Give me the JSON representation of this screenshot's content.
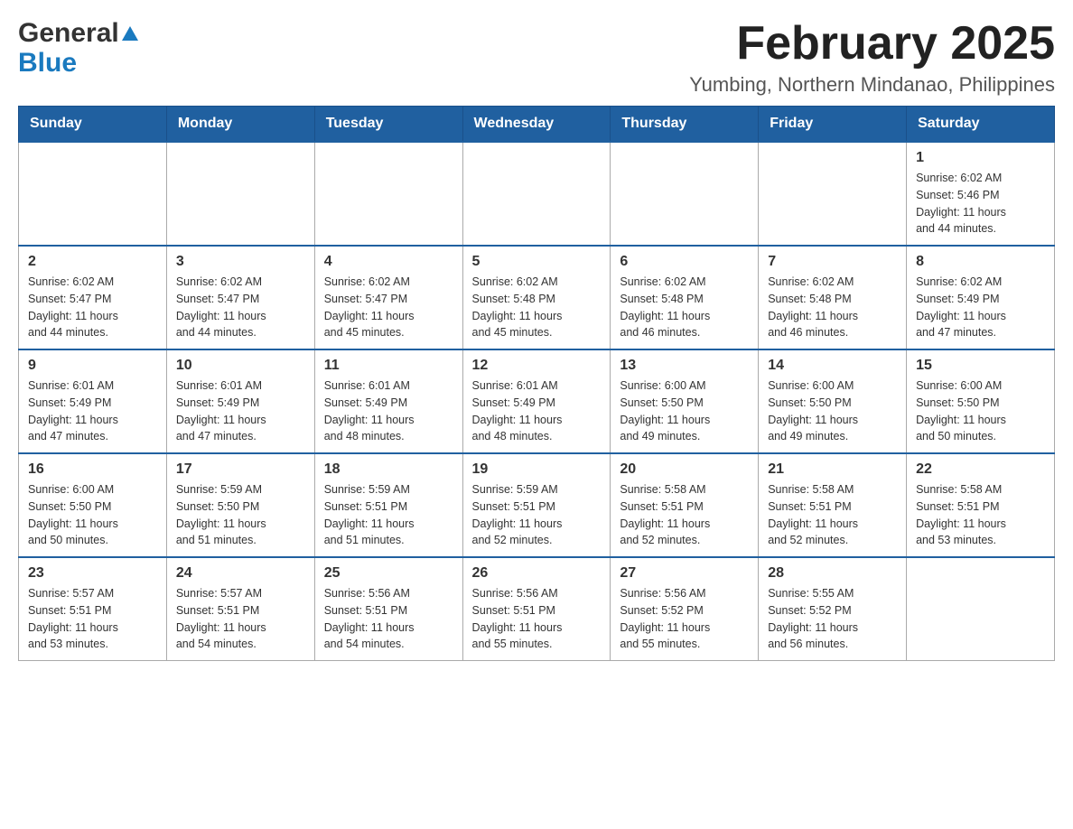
{
  "logo": {
    "general": "General",
    "blue": "Blue"
  },
  "header": {
    "month_year": "February 2025",
    "location": "Yumbing, Northern Mindanao, Philippines"
  },
  "days_of_week": [
    "Sunday",
    "Monday",
    "Tuesday",
    "Wednesday",
    "Thursday",
    "Friday",
    "Saturday"
  ],
  "weeks": [
    {
      "cells": [
        {
          "day": "",
          "info": ""
        },
        {
          "day": "",
          "info": ""
        },
        {
          "day": "",
          "info": ""
        },
        {
          "day": "",
          "info": ""
        },
        {
          "day": "",
          "info": ""
        },
        {
          "day": "",
          "info": ""
        },
        {
          "day": "1",
          "info": "Sunrise: 6:02 AM\nSunset: 5:46 PM\nDaylight: 11 hours\nand 44 minutes."
        }
      ]
    },
    {
      "cells": [
        {
          "day": "2",
          "info": "Sunrise: 6:02 AM\nSunset: 5:47 PM\nDaylight: 11 hours\nand 44 minutes."
        },
        {
          "day": "3",
          "info": "Sunrise: 6:02 AM\nSunset: 5:47 PM\nDaylight: 11 hours\nand 44 minutes."
        },
        {
          "day": "4",
          "info": "Sunrise: 6:02 AM\nSunset: 5:47 PM\nDaylight: 11 hours\nand 45 minutes."
        },
        {
          "day": "5",
          "info": "Sunrise: 6:02 AM\nSunset: 5:48 PM\nDaylight: 11 hours\nand 45 minutes."
        },
        {
          "day": "6",
          "info": "Sunrise: 6:02 AM\nSunset: 5:48 PM\nDaylight: 11 hours\nand 46 minutes."
        },
        {
          "day": "7",
          "info": "Sunrise: 6:02 AM\nSunset: 5:48 PM\nDaylight: 11 hours\nand 46 minutes."
        },
        {
          "day": "8",
          "info": "Sunrise: 6:02 AM\nSunset: 5:49 PM\nDaylight: 11 hours\nand 47 minutes."
        }
      ]
    },
    {
      "cells": [
        {
          "day": "9",
          "info": "Sunrise: 6:01 AM\nSunset: 5:49 PM\nDaylight: 11 hours\nand 47 minutes."
        },
        {
          "day": "10",
          "info": "Sunrise: 6:01 AM\nSunset: 5:49 PM\nDaylight: 11 hours\nand 47 minutes."
        },
        {
          "day": "11",
          "info": "Sunrise: 6:01 AM\nSunset: 5:49 PM\nDaylight: 11 hours\nand 48 minutes."
        },
        {
          "day": "12",
          "info": "Sunrise: 6:01 AM\nSunset: 5:49 PM\nDaylight: 11 hours\nand 48 minutes."
        },
        {
          "day": "13",
          "info": "Sunrise: 6:00 AM\nSunset: 5:50 PM\nDaylight: 11 hours\nand 49 minutes."
        },
        {
          "day": "14",
          "info": "Sunrise: 6:00 AM\nSunset: 5:50 PM\nDaylight: 11 hours\nand 49 minutes."
        },
        {
          "day": "15",
          "info": "Sunrise: 6:00 AM\nSunset: 5:50 PM\nDaylight: 11 hours\nand 50 minutes."
        }
      ]
    },
    {
      "cells": [
        {
          "day": "16",
          "info": "Sunrise: 6:00 AM\nSunset: 5:50 PM\nDaylight: 11 hours\nand 50 minutes."
        },
        {
          "day": "17",
          "info": "Sunrise: 5:59 AM\nSunset: 5:50 PM\nDaylight: 11 hours\nand 51 minutes."
        },
        {
          "day": "18",
          "info": "Sunrise: 5:59 AM\nSunset: 5:51 PM\nDaylight: 11 hours\nand 51 minutes."
        },
        {
          "day": "19",
          "info": "Sunrise: 5:59 AM\nSunset: 5:51 PM\nDaylight: 11 hours\nand 52 minutes."
        },
        {
          "day": "20",
          "info": "Sunrise: 5:58 AM\nSunset: 5:51 PM\nDaylight: 11 hours\nand 52 minutes."
        },
        {
          "day": "21",
          "info": "Sunrise: 5:58 AM\nSunset: 5:51 PM\nDaylight: 11 hours\nand 52 minutes."
        },
        {
          "day": "22",
          "info": "Sunrise: 5:58 AM\nSunset: 5:51 PM\nDaylight: 11 hours\nand 53 minutes."
        }
      ]
    },
    {
      "cells": [
        {
          "day": "23",
          "info": "Sunrise: 5:57 AM\nSunset: 5:51 PM\nDaylight: 11 hours\nand 53 minutes."
        },
        {
          "day": "24",
          "info": "Sunrise: 5:57 AM\nSunset: 5:51 PM\nDaylight: 11 hours\nand 54 minutes."
        },
        {
          "day": "25",
          "info": "Sunrise: 5:56 AM\nSunset: 5:51 PM\nDaylight: 11 hours\nand 54 minutes."
        },
        {
          "day": "26",
          "info": "Sunrise: 5:56 AM\nSunset: 5:51 PM\nDaylight: 11 hours\nand 55 minutes."
        },
        {
          "day": "27",
          "info": "Sunrise: 5:56 AM\nSunset: 5:52 PM\nDaylight: 11 hours\nand 55 minutes."
        },
        {
          "day": "28",
          "info": "Sunrise: 5:55 AM\nSunset: 5:52 PM\nDaylight: 11 hours\nand 56 minutes."
        },
        {
          "day": "",
          "info": ""
        }
      ]
    }
  ]
}
